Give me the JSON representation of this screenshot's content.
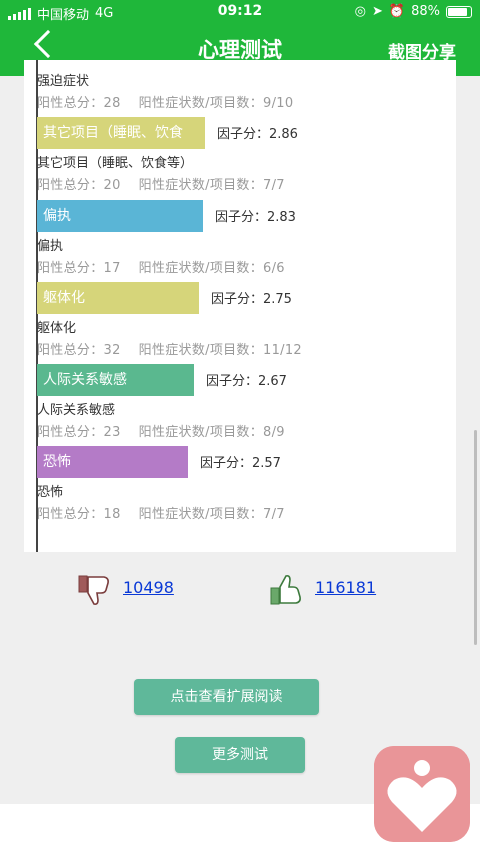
{
  "status_bar": {
    "carrier": "中国移动",
    "network": "4G",
    "time": "09:12",
    "battery": "88%"
  },
  "header": {
    "title": "心理测试",
    "share_label": "截图分享"
  },
  "top_partial": {
    "name": "强迫症状",
    "meta_total": "阳性总分：28",
    "meta_ratio": "阳性症状数/项目数：9/10"
  },
  "factors": [
    {
      "bar_label": "其它项目（睡眠、饮食",
      "factor": "因子分：2.86",
      "name": "其它项目（睡眠、饮食等）",
      "total": "阳性总分：20",
      "ratio": "阳性症状数/项目数：7/7",
      "color": "#d6d57a",
      "value": 2.86
    },
    {
      "bar_label": "偏执",
      "factor": "因子分：2.83",
      "name": "偏执",
      "total": "阳性总分：17",
      "ratio": "阳性症状数/项目数：6/6",
      "color": "#5ab5d6",
      "value": 2.83
    },
    {
      "bar_label": "躯体化",
      "factor": "因子分：2.75",
      "name": "躯体化",
      "total": "阳性总分：32",
      "ratio": "阳性症状数/项目数：11/12",
      "color": "#d6d57a",
      "value": 2.75
    },
    {
      "bar_label": "人际关系敏感",
      "factor": "因子分：2.67",
      "name": "人际关系敏感",
      "total": "阳性总分：23",
      "ratio": "阳性症状数/项目数：8/9",
      "color": "#5ab88f",
      "value": 2.67
    },
    {
      "bar_label": "恐怖",
      "factor": "因子分：2.57",
      "name": "恐怖",
      "total": "阳性总分：18",
      "ratio": "阳性症状数/项目数：7/7",
      "color": "#b47bc7",
      "value": 2.57
    }
  ],
  "votes": {
    "dislike": "10498",
    "like": "116181"
  },
  "buttons": {
    "read_more": "点击查看扩展阅读",
    "more_tests": "更多测试"
  }
}
